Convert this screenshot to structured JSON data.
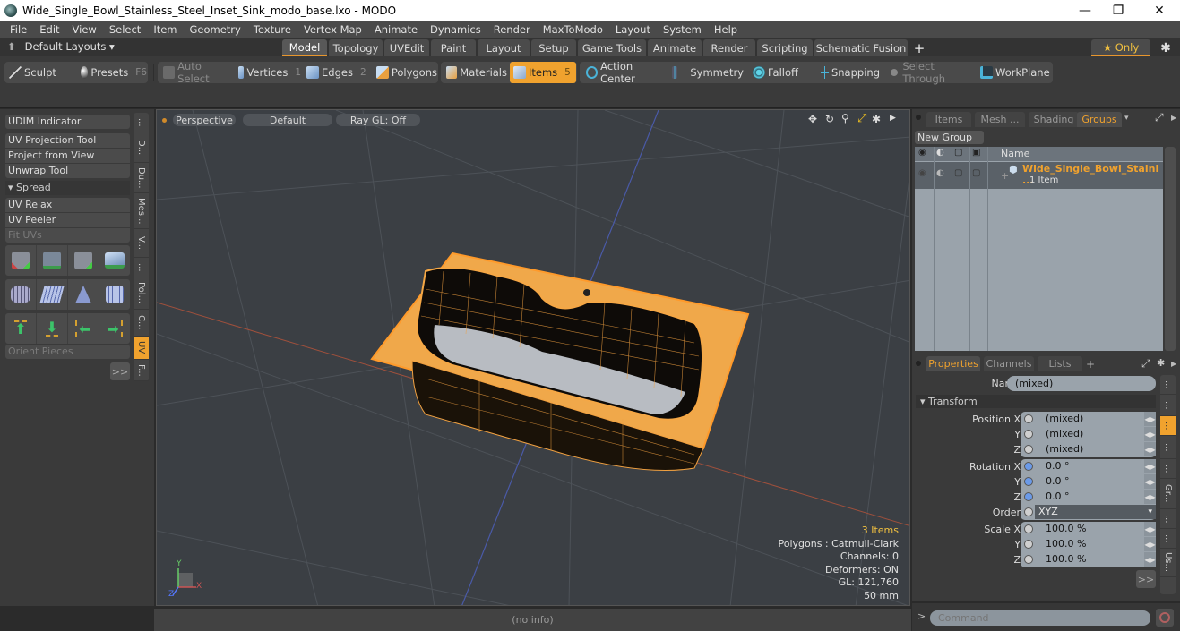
{
  "window": {
    "title": "Wide_Single_Bowl_Stainless_Steel_Inset_Sink_modo_base.lxo - MODO",
    "controls": {
      "minimize": "—",
      "maximize": "❐",
      "close": "✕"
    }
  },
  "menubar": [
    "File",
    "Edit",
    "View",
    "Select",
    "Item",
    "Geometry",
    "Texture",
    "Vertex Map",
    "Animate",
    "Dynamics",
    "Render",
    "MaxToModo",
    "Layout",
    "System",
    "Help"
  ],
  "layoutbar": {
    "default_layouts": "Default Layouts ▾",
    "tabs": [
      "Model",
      "Topology",
      "UVEdit",
      "Paint",
      "Layout",
      "Setup",
      "Game Tools",
      "Animate",
      "Render",
      "Scripting",
      "Schematic Fusion"
    ],
    "active_tab": "Model",
    "add": "+",
    "only_label": "★ Only"
  },
  "toolbar": {
    "sculpt": "Sculpt",
    "presets": "Presets",
    "presets_hotkey": "F6",
    "auto_select": "Auto Select",
    "vertices": "Vertices",
    "vertices_hotkey": "1",
    "edges": "Edges",
    "edges_hotkey": "2",
    "polygons": "Polygons",
    "materials": "Materials",
    "items": "Items",
    "items_hotkey": "5",
    "action_center": "Action Center",
    "symmetry": "Symmetry",
    "falloff": "Falloff",
    "snapping": "Snapping",
    "select_through": "Select Through",
    "workplane": "WorkPlane"
  },
  "leftpanel": {
    "items": [
      {
        "label": "UDIM Indicator"
      },
      {
        "label": "UV Projection Tool"
      },
      {
        "label": "Project from View"
      },
      {
        "label": "Unwrap Tool"
      },
      {
        "label": "▾ Spread"
      },
      {
        "label": "UV Relax"
      },
      {
        "label": "UV Peeler"
      },
      {
        "label": "Fit UVs"
      }
    ],
    "orient_pieces": "Orient Pieces",
    "more": ">>",
    "vtabs": [
      "...",
      "D...",
      "Du...",
      "Mes...",
      "V...",
      "...",
      "Pol...",
      "C...",
      "UV",
      "F..."
    ]
  },
  "viewport": {
    "view": "Perspective",
    "shading": "Default",
    "raygl": "Ray GL: Off",
    "info": {
      "items": "3 Items",
      "polygons": "Polygons : Catmull-Clark",
      "channels": "Channels: 0",
      "deformers": "Deformers: ON",
      "gl": "GL: 121,760",
      "unit": "50 mm"
    },
    "axis": {
      "y": "Y",
      "x": "X",
      "z": "Z"
    }
  },
  "statusbar": {
    "text": "(no info)"
  },
  "rightpanel": {
    "tabs": [
      "Items",
      "Mesh ...",
      "Shading",
      "Groups"
    ],
    "active_tab": "Groups",
    "new_group": "New Group",
    "list_header": "Name",
    "group": {
      "name": "Wide_Single_Bowl_Stainl ...",
      "count": "1 Item"
    },
    "prop_tabs": [
      "Properties",
      "Channels",
      "Lists"
    ],
    "prop_active": "Properties",
    "name_label": "Name",
    "name_value": "(mixed)",
    "transform_label": "▾ Transform",
    "position": {
      "label": "Position X",
      "x": "(mixed)",
      "y": "(mixed)",
      "z": "(mixed)"
    },
    "rotation": {
      "label": "Rotation X",
      "x": "0.0 °",
      "y": "0.0 °",
      "z": "0.0 °"
    },
    "order": {
      "label": "Order",
      "value": "XYZ"
    },
    "scale": {
      "label": "Scale X",
      "x": "100.0 %",
      "y": "100.0 %",
      "z": "100.0 %"
    },
    "axis_y": "Y",
    "axis_z": "Z",
    "more": ">>",
    "command_placeholder": "Command",
    "command_prompt": ">",
    "rvtabs": [
      "...",
      "...",
      "...",
      "...",
      "...",
      "Gr...",
      "...",
      "...",
      "Us..."
    ]
  }
}
